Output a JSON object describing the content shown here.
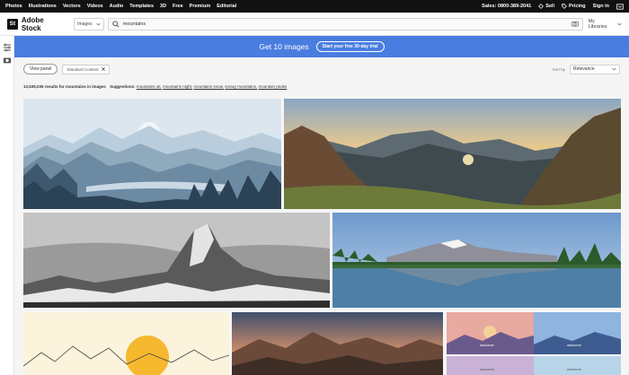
{
  "topnav": {
    "links": [
      "Photos",
      "Illustrations",
      "Vectors",
      "Videos",
      "Audio",
      "Templates",
      "3D",
      "Free",
      "Premium",
      "Editorial"
    ],
    "sales": "Sales: 0800-389-2041",
    "sell": "Sell",
    "pricing": "Pricing",
    "signin": "Sign in"
  },
  "header": {
    "logo_mark": "St",
    "logo_text": "Adobe Stock",
    "asset_type": "Images",
    "search_value": "mountains",
    "my_libraries": "My Libraries"
  },
  "banner": {
    "message": "Get 10 images",
    "cta": "Start your free 30-day trial"
  },
  "filters": {
    "view_panel": "View panel",
    "chip": "Standard Content",
    "sort_label": "Sort by",
    "sort_value": "Relevance"
  },
  "results": {
    "count_text": "13,539,035 results for mountains in images",
    "suggestions_label": "Suggestions:",
    "suggestions": [
      "mountains uk,",
      "mountains night,",
      "mountains snow,",
      "snowy mountains,",
      "mountain peaks"
    ]
  },
  "icons": {
    "search": "search-icon",
    "camera": "camera-icon",
    "filters": "filters-icon",
    "cart": "cart-icon",
    "sell": "sell-icon",
    "pricing": "tag-icon",
    "close": "close-icon"
  },
  "colors": {
    "banner": "#4a7de0",
    "topnav": "#111111"
  },
  "images": {
    "welcome_text": "welcome"
  }
}
